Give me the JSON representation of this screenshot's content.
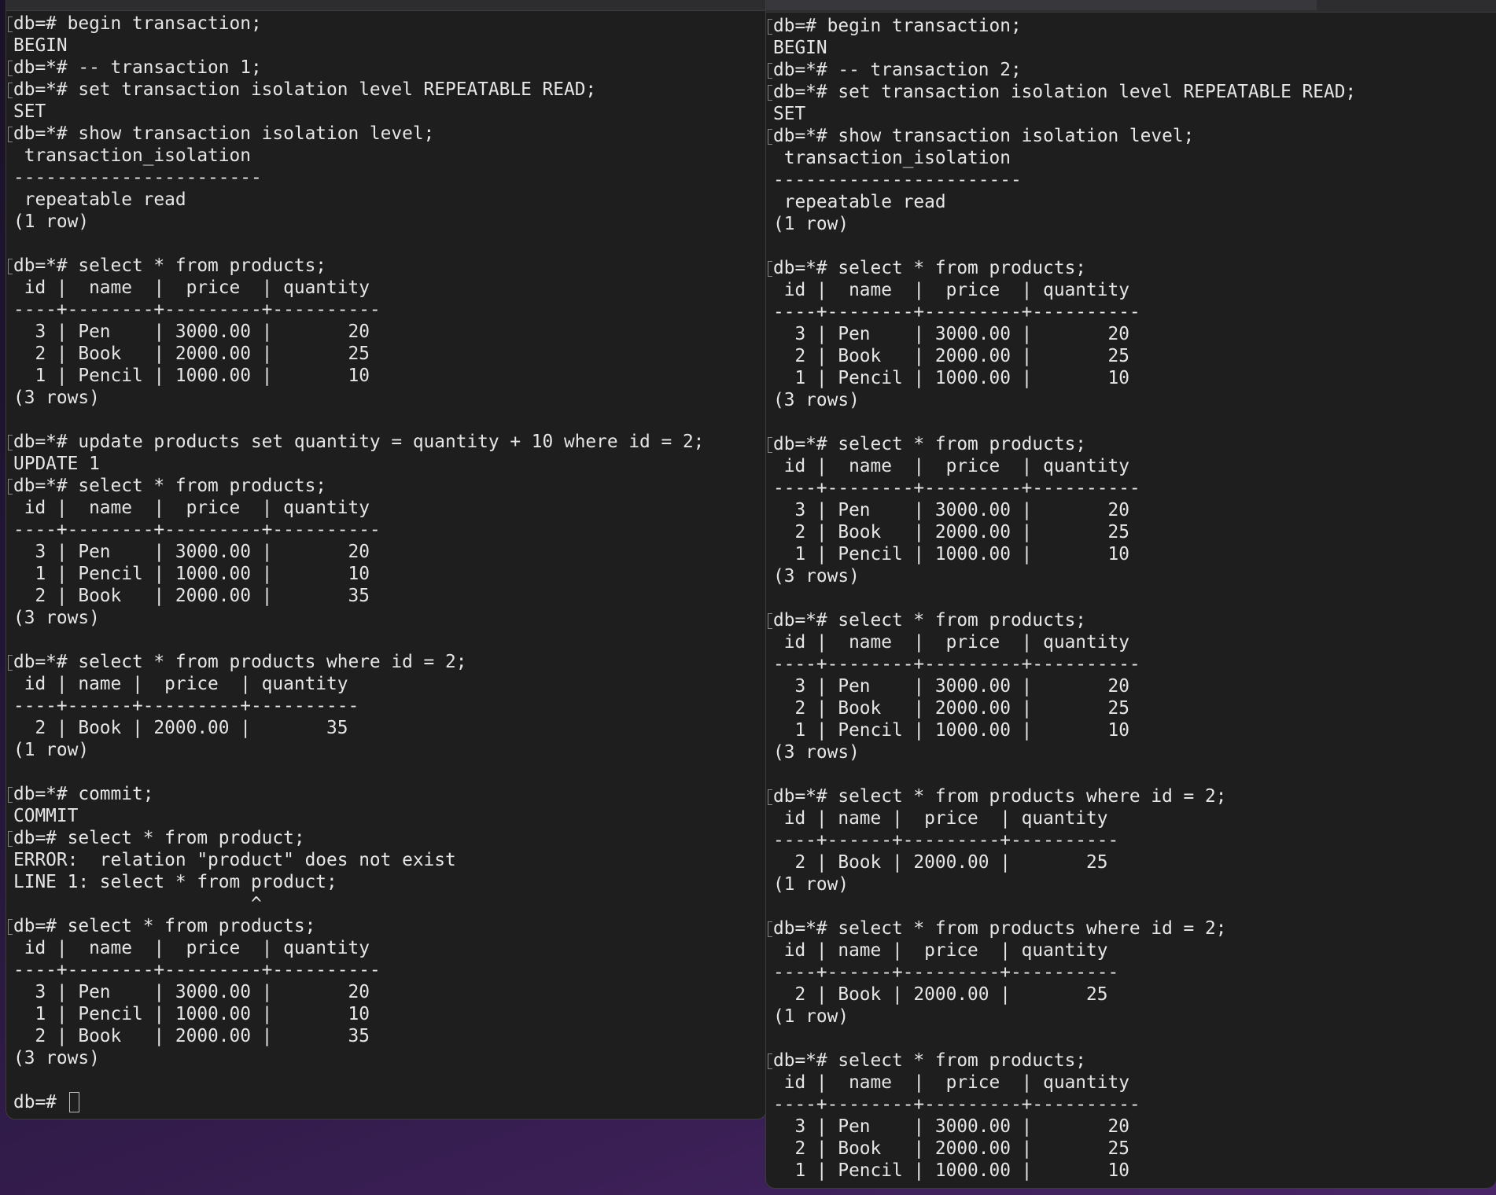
{
  "left_terminal": {
    "lines": [
      {
        "text": "db=# begin transaction;",
        "prompt": true
      },
      {
        "text": "BEGIN"
      },
      {
        "text": "db=*# -- transaction 1;",
        "prompt": true
      },
      {
        "text": "db=*# set transaction isolation level REPEATABLE READ;",
        "prompt": true
      },
      {
        "text": "SET"
      },
      {
        "text": "db=*# show transaction isolation level;",
        "prompt": true
      },
      {
        "text": " transaction_isolation"
      },
      {
        "text": "-----------------------"
      },
      {
        "text": " repeatable read"
      },
      {
        "text": "(1 row)"
      },
      {
        "text": ""
      },
      {
        "text": "db=*# select * from products;",
        "prompt": true
      },
      {
        "text": " id |  name  |  price  | quantity"
      },
      {
        "text": "----+--------+---------+----------"
      },
      {
        "text": "  3 | Pen    | 3000.00 |       20"
      },
      {
        "text": "  2 | Book   | 2000.00 |       25"
      },
      {
        "text": "  1 | Pencil | 1000.00 |       10"
      },
      {
        "text": "(3 rows)"
      },
      {
        "text": ""
      },
      {
        "text": "db=*# update products set quantity = quantity + 10 where id = 2;",
        "prompt": true
      },
      {
        "text": "UPDATE 1"
      },
      {
        "text": "db=*# select * from products;",
        "prompt": true
      },
      {
        "text": " id |  name  |  price  | quantity"
      },
      {
        "text": "----+--------+---------+----------"
      },
      {
        "text": "  3 | Pen    | 3000.00 |       20"
      },
      {
        "text": "  1 | Pencil | 1000.00 |       10"
      },
      {
        "text": "  2 | Book   | 2000.00 |       35"
      },
      {
        "text": "(3 rows)"
      },
      {
        "text": ""
      },
      {
        "text": "db=*# select * from products where id = 2;",
        "prompt": true
      },
      {
        "text": " id | name |  price  | quantity"
      },
      {
        "text": "----+------+---------+----------"
      },
      {
        "text": "  2 | Book | 2000.00 |       35"
      },
      {
        "text": "(1 row)"
      },
      {
        "text": ""
      },
      {
        "text": "db=*# commit;",
        "prompt": true
      },
      {
        "text": "COMMIT"
      },
      {
        "text": "db=# select * from product;",
        "prompt": true
      },
      {
        "text": "ERROR:  relation \"product\" does not exist"
      },
      {
        "text": "LINE 1: select * from product;"
      },
      {
        "text": "                      ^"
      },
      {
        "text": "db=# select * from products;",
        "prompt": true
      },
      {
        "text": " id |  name  |  price  | quantity"
      },
      {
        "text": "----+--------+---------+----------"
      },
      {
        "text": "  3 | Pen    | 3000.00 |       20"
      },
      {
        "text": "  1 | Pencil | 1000.00 |       10"
      },
      {
        "text": "  2 | Book   | 2000.00 |       35"
      },
      {
        "text": "(3 rows)"
      },
      {
        "text": ""
      }
    ],
    "current_prompt": "db=# "
  },
  "right_terminal": {
    "lines": [
      {
        "text": "db=# begin transaction;",
        "prompt": true
      },
      {
        "text": "BEGIN"
      },
      {
        "text": "db=*# -- transaction 2;",
        "prompt": true
      },
      {
        "text": "db=*# set transaction isolation level REPEATABLE READ;",
        "prompt": true
      },
      {
        "text": "SET"
      },
      {
        "text": "db=*# show transaction isolation level;",
        "prompt": true
      },
      {
        "text": " transaction_isolation"
      },
      {
        "text": "-----------------------"
      },
      {
        "text": " repeatable read"
      },
      {
        "text": "(1 row)"
      },
      {
        "text": ""
      },
      {
        "text": "db=*# select * from products;",
        "prompt": true
      },
      {
        "text": " id |  name  |  price  | quantity"
      },
      {
        "text": "----+--------+---------+----------"
      },
      {
        "text": "  3 | Pen    | 3000.00 |       20"
      },
      {
        "text": "  2 | Book   | 2000.00 |       25"
      },
      {
        "text": "  1 | Pencil | 1000.00 |       10"
      },
      {
        "text": "(3 rows)"
      },
      {
        "text": ""
      },
      {
        "text": "db=*# select * from products;",
        "prompt": true
      },
      {
        "text": " id |  name  |  price  | quantity"
      },
      {
        "text": "----+--------+---------+----------"
      },
      {
        "text": "  3 | Pen    | 3000.00 |       20"
      },
      {
        "text": "  2 | Book   | 2000.00 |       25"
      },
      {
        "text": "  1 | Pencil | 1000.00 |       10"
      },
      {
        "text": "(3 rows)"
      },
      {
        "text": ""
      },
      {
        "text": "db=*# select * from products;",
        "prompt": true
      },
      {
        "text": " id |  name  |  price  | quantity"
      },
      {
        "text": "----+--------+---------+----------"
      },
      {
        "text": "  3 | Pen    | 3000.00 |       20"
      },
      {
        "text": "  2 | Book   | 2000.00 |       25"
      },
      {
        "text": "  1 | Pencil | 1000.00 |       10"
      },
      {
        "text": "(3 rows)"
      },
      {
        "text": ""
      },
      {
        "text": "db=*# select * from products where id = 2;",
        "prompt": true
      },
      {
        "text": " id | name |  price  | quantity"
      },
      {
        "text": "----+------+---------+----------"
      },
      {
        "text": "  2 | Book | 2000.00 |       25"
      },
      {
        "text": "(1 row)"
      },
      {
        "text": ""
      },
      {
        "text": "db=*# select * from products where id = 2;",
        "prompt": true
      },
      {
        "text": " id | name |  price  | quantity"
      },
      {
        "text": "----+------+---------+----------"
      },
      {
        "text": "  2 | Book | 2000.00 |       25"
      },
      {
        "text": "(1 row)"
      },
      {
        "text": ""
      },
      {
        "text": "db=*# select * from products;",
        "prompt": true
      },
      {
        "text": " id |  name  |  price  | quantity"
      },
      {
        "text": "----+--------+---------+----------"
      },
      {
        "text": "  3 | Pen    | 3000.00 |       20"
      },
      {
        "text": "  2 | Book   | 2000.00 |       25"
      },
      {
        "text": "  1 | Pencil | 1000.00 |       10"
      }
    ]
  }
}
